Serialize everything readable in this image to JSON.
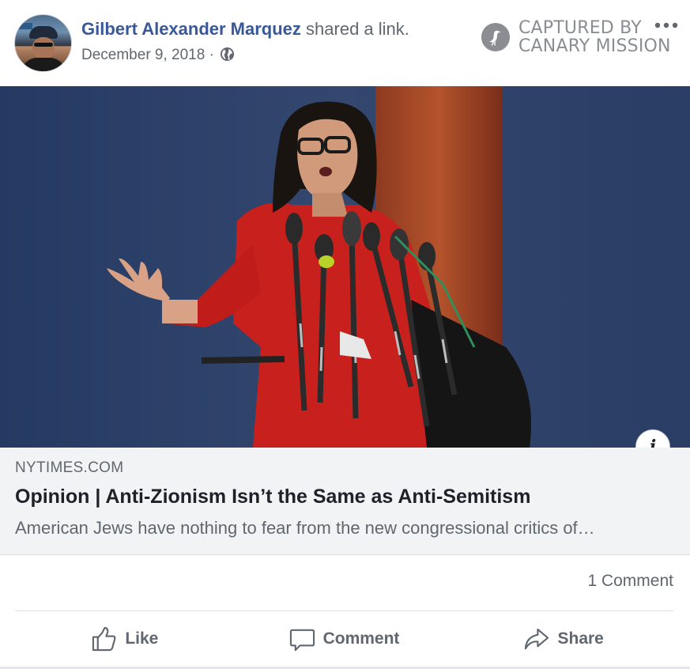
{
  "post": {
    "author": "Gilbert Alexander Marquez",
    "action_text": " shared a link.",
    "date": "December 9, 2018",
    "separator": " · ",
    "privacy_icon": "globe-icon"
  },
  "watermark": {
    "line1": "CAPTURED BY",
    "line2": "CANARY MISSION",
    "icon": "canary-bird-icon"
  },
  "menu_icon": "more-options-icon",
  "link_preview": {
    "domain": "NYTIMES.COM",
    "title": "Opinion | Anti-Zionism Isn’t the Same as Anti-Semitism",
    "description": "American Jews have nothing to fear from the new congressional critics of…",
    "info_icon": "i"
  },
  "stats": {
    "comments": "1 Comment"
  },
  "actions": {
    "like": "Like",
    "comment": "Comment",
    "share": "Share"
  },
  "colors": {
    "author_link": "#385898",
    "secondary_text": "#606770",
    "preview_bg": "#f2f3f5"
  }
}
